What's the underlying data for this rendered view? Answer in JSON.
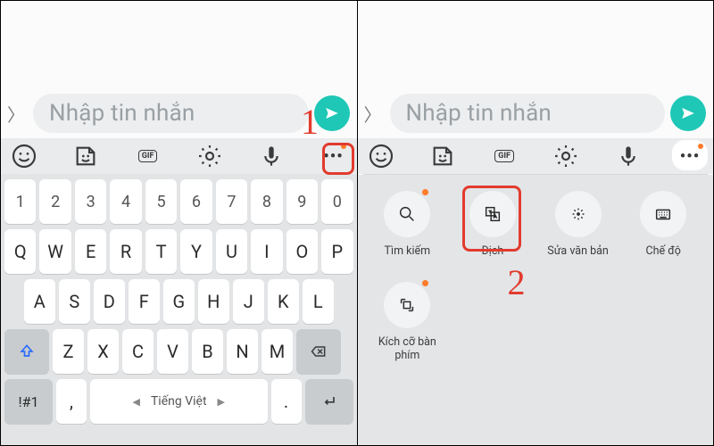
{
  "input": {
    "placeholder": "Nhập tin nhắn"
  },
  "toolbar": {
    "gif": "GIF"
  },
  "keyboard": {
    "numbers": [
      "1",
      "2",
      "3",
      "4",
      "5",
      "6",
      "7",
      "8",
      "9",
      "0"
    ],
    "row1": [
      "Q",
      "W",
      "E",
      "R",
      "T",
      "Y",
      "U",
      "I",
      "O",
      "P"
    ],
    "row2": [
      "A",
      "S",
      "D",
      "F",
      "G",
      "H",
      "J",
      "K",
      "L"
    ],
    "row3": [
      "Z",
      "X",
      "C",
      "V",
      "B",
      "N",
      "M"
    ],
    "sym": "!#1",
    "comma": ",",
    "period": ".",
    "space_label": "Tiếng Việt"
  },
  "tools": {
    "search": "Tìm kiếm",
    "translate": "Dịch",
    "edit": "Sửa văn bản",
    "mode": "Chế độ",
    "resize": "Kích cỡ bàn phím"
  },
  "callouts": {
    "one": "1",
    "two": "2"
  }
}
